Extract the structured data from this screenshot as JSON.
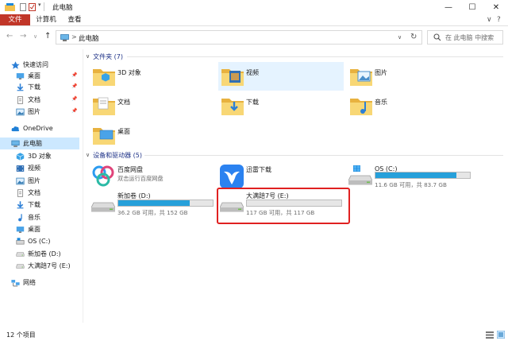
{
  "window": {
    "title": "此电脑",
    "minimize": "—",
    "maximize": "☐",
    "close": "✕"
  },
  "ribbon": {
    "tabs": [
      "文件",
      "计算机",
      "查看"
    ],
    "collapse": "∨",
    "help": "?"
  },
  "nav": {
    "back": "←",
    "forward": "→",
    "recent": "∨",
    "up": "↑",
    "address_separator": ">",
    "address": "此电脑",
    "dropdown": "∨",
    "refresh": "↻"
  },
  "search": {
    "placeholder": "在 此电脑 中搜索"
  },
  "sidebar": {
    "items": [
      {
        "label": "快速访问",
        "icon": "star-icon",
        "pinned": false
      },
      {
        "label": "桌面",
        "icon": "desktop-folder-icon",
        "pinned": true
      },
      {
        "label": "下载",
        "icon": "download-icon",
        "pinned": true
      },
      {
        "label": "文档",
        "icon": "document-icon",
        "pinned": true
      },
      {
        "label": "图片",
        "icon": "picture-icon",
        "pinned": true
      },
      {
        "label": "OneDrive",
        "icon": "cloud-icon",
        "pinned": false
      },
      {
        "label": "此电脑",
        "icon": "computer-icon",
        "pinned": false
      },
      {
        "label": "3D 对象",
        "icon": "cube-icon",
        "pinned": false
      },
      {
        "label": "视频",
        "icon": "video-icon",
        "pinned": false
      },
      {
        "label": "图片",
        "icon": "picture-icon",
        "pinned": false
      },
      {
        "label": "文档",
        "icon": "document-icon",
        "pinned": false
      },
      {
        "label": "下载",
        "icon": "download-icon",
        "pinned": false
      },
      {
        "label": "音乐",
        "icon": "music-icon",
        "pinned": false
      },
      {
        "label": "桌面",
        "icon": "desktop-folder-icon",
        "pinned": false
      },
      {
        "label": "OS (C:)",
        "icon": "os-drive-icon",
        "pinned": false
      },
      {
        "label": "新加卷 (D:)",
        "icon": "drive-icon",
        "pinned": false
      },
      {
        "label": "大满踣7号 (E:)",
        "icon": "drive-icon",
        "pinned": false
      },
      {
        "label": "网络",
        "icon": "network-icon",
        "pinned": false
      }
    ]
  },
  "folders": {
    "header": "文件夹 (7)",
    "items": [
      {
        "label": "3D 对象",
        "icon": "cube-folder-icon"
      },
      {
        "label": "视频",
        "icon": "video-folder-icon"
      },
      {
        "label": "图片",
        "icon": "picture-folder-icon"
      },
      {
        "label": "文档",
        "icon": "document-folder-icon"
      },
      {
        "label": "下载",
        "icon": "download-folder-icon"
      },
      {
        "label": "音乐",
        "icon": "music-folder-icon"
      },
      {
        "label": "桌面",
        "icon": "desktop-folder-icon"
      }
    ]
  },
  "devices": {
    "header": "设备和驱动器 (5)",
    "items": [
      {
        "label": "百度网盘",
        "sub": "双击运行百度网盘",
        "icon": "baidu-netdisk-icon"
      },
      {
        "label": "迅雷下载",
        "sub": "",
        "icon": "xunlei-icon"
      },
      {
        "label": "OS (C:)",
        "sub": "11.6 GB 可用，共 83.7 GB",
        "icon": "os-drive-icon",
        "used_fraction": 0.86
      },
      {
        "label": "新加卷 (D:)",
        "sub": "36.2 GB 可用，共 152 GB",
        "icon": "drive-icon",
        "used_fraction": 0.76
      },
      {
        "label": "大满踣7号 (E:)",
        "sub": "117 GB 可用，共 117 GB",
        "icon": "drive-icon",
        "used_fraction": 0.0
      }
    ]
  },
  "status": {
    "count": "12 个项目"
  },
  "colors": {
    "accent": "#26a0da",
    "file_tab": "#c13628",
    "selection": "#cce8ff",
    "highlight_box": "#e02121",
    "folder": "#f3c24e"
  }
}
